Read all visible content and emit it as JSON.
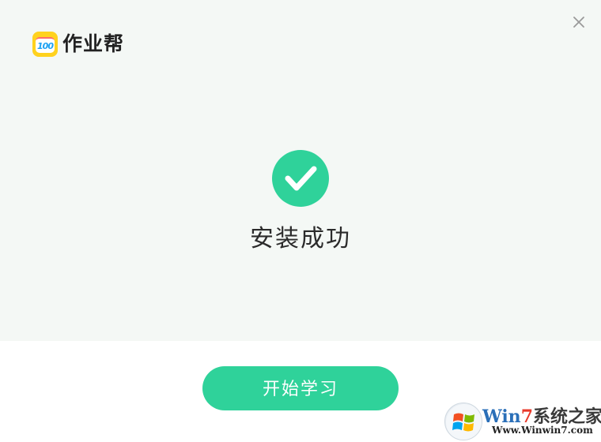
{
  "app": {
    "name": "作业帮",
    "logo_text": "100"
  },
  "status": {
    "title": "安装成功"
  },
  "actions": {
    "start_label": "开始学习"
  },
  "watermark": {
    "brand_part1": "Win",
    "brand_part2": "7",
    "brand_part3": "系统之家",
    "url": "Www.Winwin7.com"
  },
  "icons": {
    "close": "close-icon",
    "success": "check-circle-icon",
    "windows": "windows-logo-icon"
  },
  "colors": {
    "accent": "#2fd29a",
    "panel_bg": "#f4f8f5",
    "logo_yellow": "#ffd21e"
  }
}
